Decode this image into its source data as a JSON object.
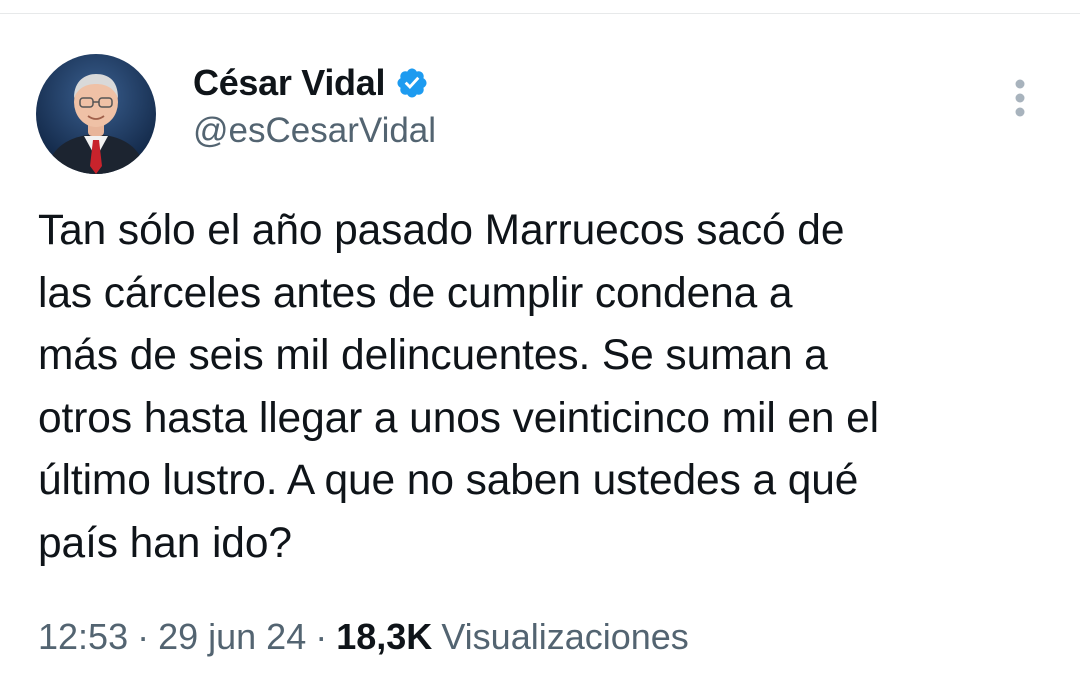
{
  "author": {
    "display_name": "César Vidal",
    "handle": "@esCesarVidal",
    "verified": true,
    "verified_color": "#1d9bf0"
  },
  "icons": {
    "avatar": "profile-photo",
    "verified": "verified-badge-icon",
    "more": "more-vertical-icon"
  },
  "tweet": {
    "text_lines": [
      "Tan sólo el año pasado Marruecos sacó de",
      "las cárceles antes de cumplir condena a",
      "más de seis mil delincuentes. Se suman a",
      "otros hasta llegar a unos veinticinco mil en el",
      "último lustro. A que no saben ustedes a qué",
      "país han ido?"
    ]
  },
  "meta": {
    "time": "12:53",
    "separator": "·",
    "date": "29 jun 24",
    "views_count": "18,3K",
    "views_label": "Visualizaciones"
  }
}
